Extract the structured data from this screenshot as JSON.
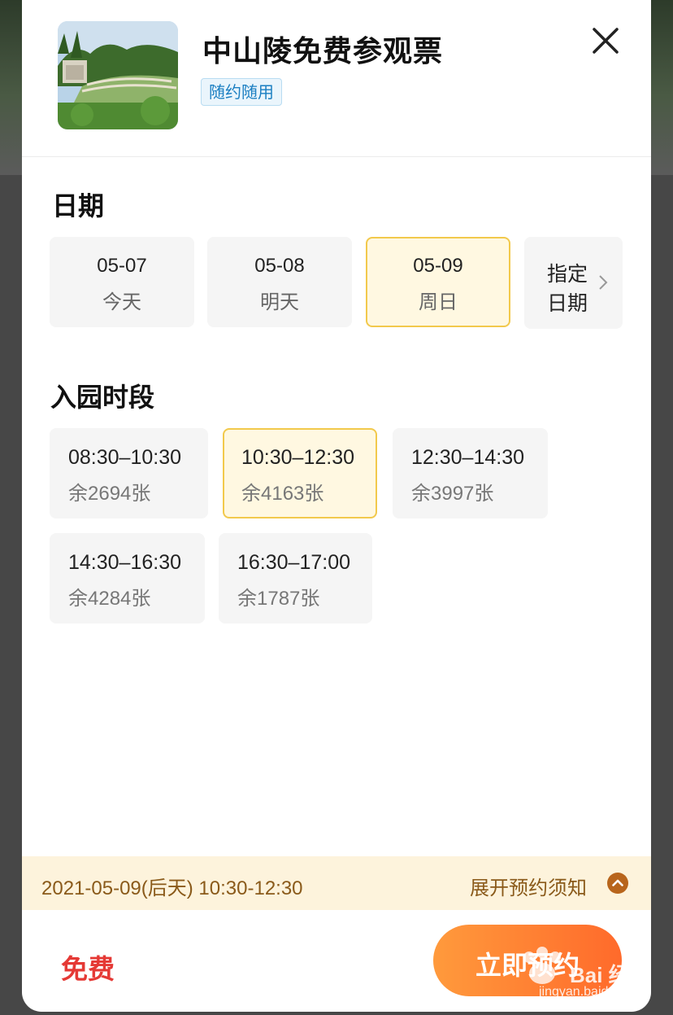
{
  "ticket": {
    "title": "中山陵免费参观票",
    "tag": "随约随用"
  },
  "date_section": {
    "title": "日期",
    "options": [
      {
        "date": "05-07",
        "label": "今天",
        "selected": false
      },
      {
        "date": "05-08",
        "label": "明天",
        "selected": false
      },
      {
        "date": "05-09",
        "label": "周日",
        "selected": true
      }
    ],
    "more": {
      "line1": "指定",
      "line2": "日期"
    }
  },
  "time_section": {
    "title": "入园时段",
    "slots": [
      {
        "time": "08:30–10:30",
        "remaining": "余2694张",
        "selected": false
      },
      {
        "time": "10:30–12:30",
        "remaining": "余4163张",
        "selected": true
      },
      {
        "time": "12:30–14:30",
        "remaining": "余3997张",
        "selected": false
      },
      {
        "time": "14:30–16:30",
        "remaining": "余4284张",
        "selected": false
      },
      {
        "time": "16:30–17:00",
        "remaining": "余1787张",
        "selected": false
      }
    ]
  },
  "summary": {
    "selection": "2021-05-09(后天) 10:30-12:30",
    "notice_link": "展开预约须知"
  },
  "footer": {
    "price": "免费",
    "book_button": "立即预约"
  },
  "watermark": {
    "brand": "Bai 经验",
    "url": "jingyan.baidu.com"
  },
  "colors": {
    "accent_border": "#f2c94c",
    "selected_bg": "#fff8e1",
    "price": "#e53935",
    "button_start": "#ff9a3c",
    "button_end": "#ff6a2b",
    "tag_text": "#1b7fc2",
    "summary_text": "#8a5a1a"
  }
}
